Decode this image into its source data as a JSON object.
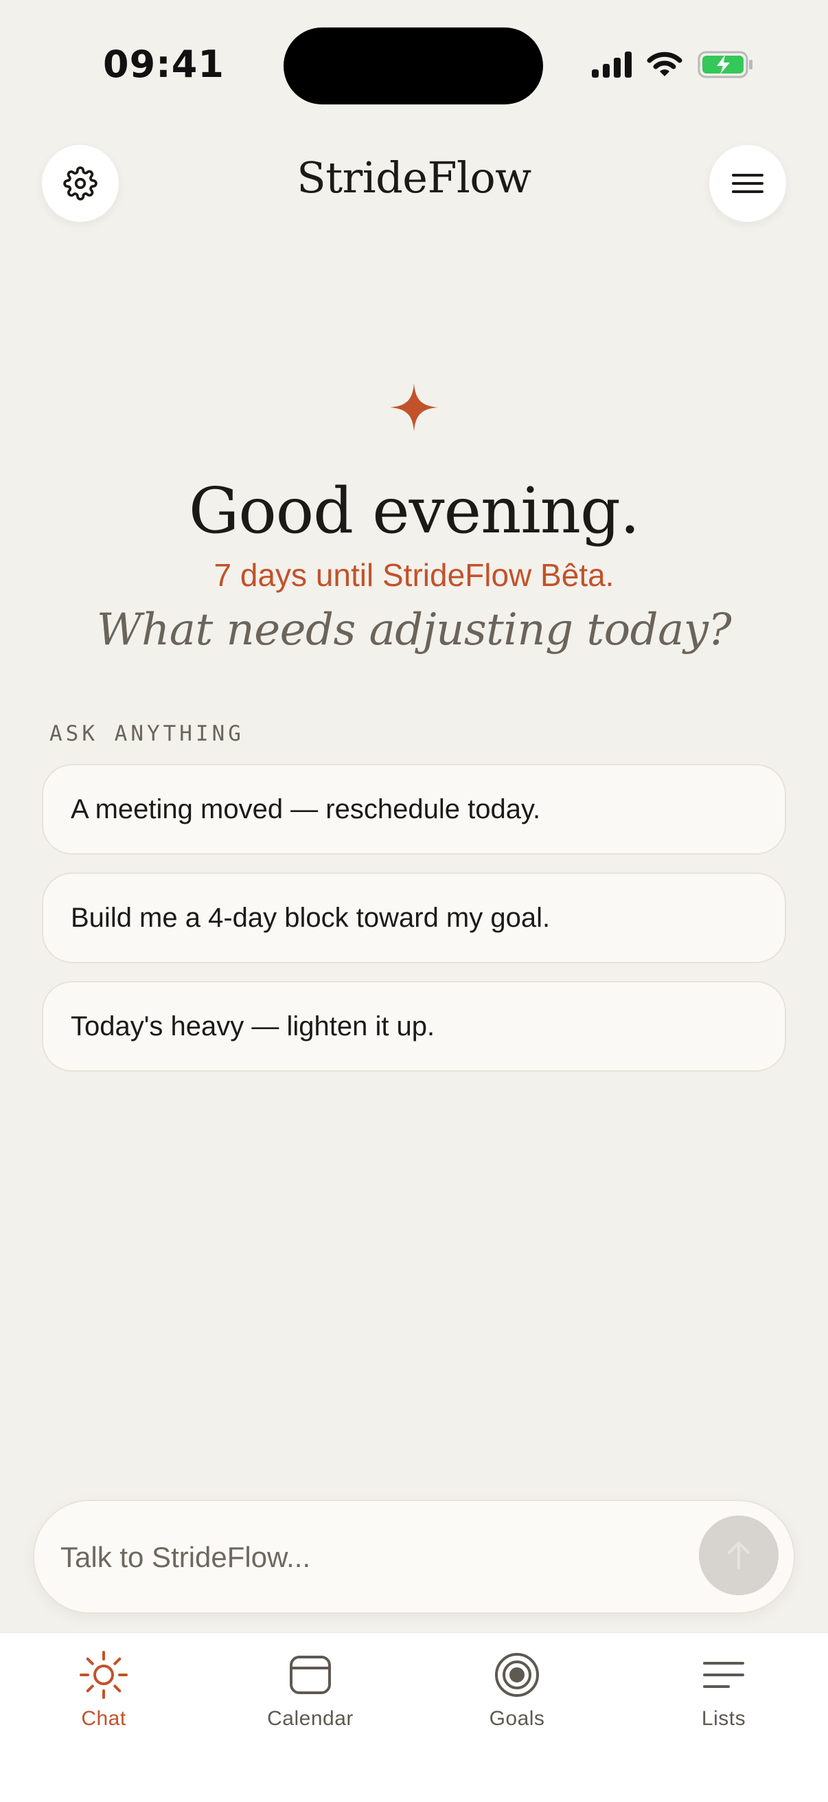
{
  "status_bar": {
    "time": "09:41"
  },
  "header": {
    "title": "StrideFlow"
  },
  "hero": {
    "greeting": "Good evening.",
    "countdown": "7 days until StrideFlow Bêta.",
    "prompt": "What needs adjusting today?"
  },
  "suggestions": {
    "label": "ASK ANYTHING",
    "items": [
      "A meeting moved — reschedule today.",
      "Build me a 4-day block toward my goal.",
      "Today's heavy — lighten it up."
    ]
  },
  "composer": {
    "placeholder": "Talk to StrideFlow..."
  },
  "tabs": [
    {
      "label": "Chat",
      "icon": "sun-icon",
      "active": true
    },
    {
      "label": "Calendar",
      "icon": "calendar-icon",
      "active": false
    },
    {
      "label": "Goals",
      "icon": "target-icon",
      "active": false
    },
    {
      "label": "Lists",
      "icon": "list-icon",
      "active": false
    }
  ],
  "colors": {
    "background": "#f3f1ec",
    "accent": "#c2522a",
    "muted_text": "#6b645b",
    "battery": "#34c759"
  }
}
